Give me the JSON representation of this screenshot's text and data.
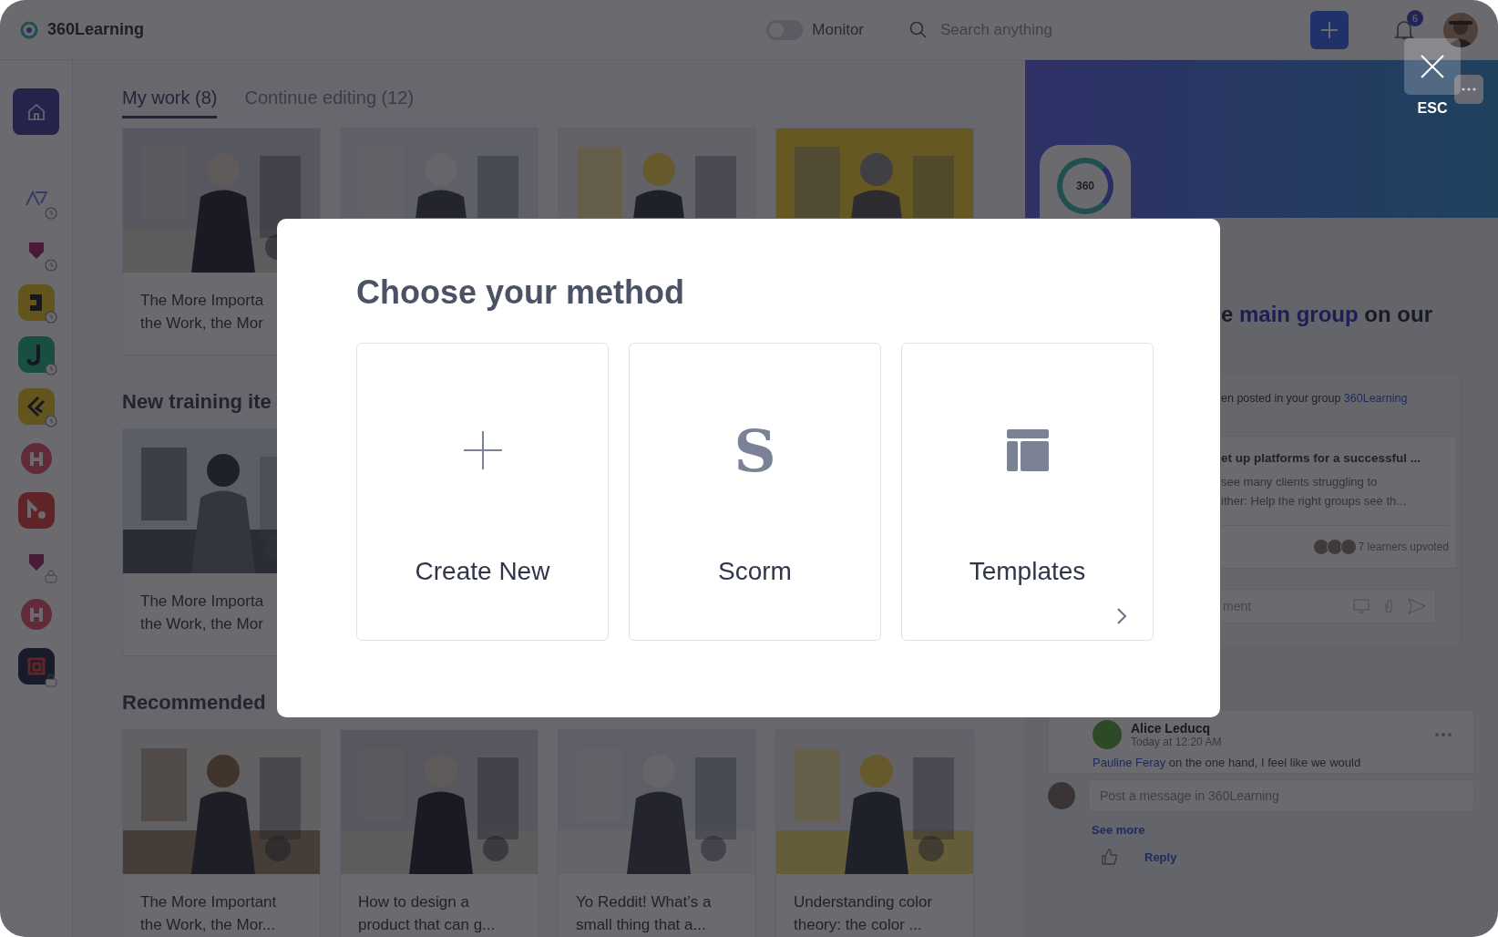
{
  "topbar": {
    "brand": "360Learning",
    "monitor": {
      "label": "Monitor",
      "on": false
    },
    "search": {
      "placeholder": "Search anything"
    },
    "notifications": "6"
  },
  "close": {
    "label": "ESC"
  },
  "sidebar": {
    "home": {
      "selected": true
    },
    "apps": [
      {
        "kind": "mark",
        "pending": true,
        "locked": false
      },
      {
        "kind": "shield",
        "pending": true,
        "locked": false
      },
      {
        "kind": "bracket",
        "pending": true,
        "locked": false
      },
      {
        "kind": "leaf",
        "pending": true,
        "locked": false
      },
      {
        "kind": "arrows",
        "pending": true,
        "locked": false
      },
      {
        "kind": "circle",
        "pending": false,
        "locked": false
      },
      {
        "kind": "dot",
        "pending": false,
        "locked": false
      },
      {
        "kind": "shield",
        "pending": false,
        "locked": true
      },
      {
        "kind": "circle",
        "pending": false,
        "locked": false
      },
      {
        "kind": "frame",
        "pending": false,
        "locked": true
      }
    ]
  },
  "tabs": [
    {
      "label": "My work (8)",
      "selected": true
    },
    {
      "label": "Continue editing (12)",
      "selected": false
    }
  ],
  "sections": [
    {
      "cards": [
        {
          "kind": "picture",
          "title": "The More Importa\nthe Work, the Mor"
        },
        {
          "kind": "picture"
        },
        {
          "kind": "picture"
        },
        {
          "kind": "picture"
        }
      ]
    },
    {
      "heading": "New training ite",
      "cards": [
        {
          "kind": "picture",
          "title": "The More Importa\nthe Work, the Mor"
        }
      ]
    },
    {
      "heading": "Recommended",
      "cards": [
        {
          "kind": "picture",
          "title": "The More Important\nthe Work, the Mor..."
        },
        {
          "kind": "picture",
          "title": "How to design a\nproduct that can g..."
        },
        {
          "kind": "picture",
          "title": "Yo Reddit! What’s a\nsmall thing that a..."
        },
        {
          "kind": "picture",
          "title": "Understanding color\ntheory: the color ..."
        }
      ]
    }
  ],
  "panel": {
    "logo": "360",
    "headline": {
      "before": "e ",
      "link": "main group",
      "after": " on our"
    },
    "notice": {
      "text": "en posted in your group ",
      "link": "360Learning"
    },
    "post": {
      "title": "et up platforms for a successful ...",
      "excerpt": "see many clients struggling to\nither: Help the right groups see th...",
      "upvotes": "7 learners upvoted"
    },
    "comment": {
      "placeholder": "ment"
    },
    "reply": {
      "author": "Alice Leducq",
      "time": "Today at 12:20 AM",
      "mention": "Pauline Feray",
      "text": " on the one hand, I feel like we would"
    },
    "message": {
      "placeholder": "Post a message in 360Learning"
    },
    "see_more": "See more",
    "reply_label": "Reply"
  },
  "modal": {
    "title": "Choose your method",
    "options": [
      {
        "kind": "plus",
        "label": "Create New",
        "chevron": false
      },
      {
        "kind": "glyph",
        "glyph": "S",
        "label": "Scorm",
        "chevron": false
      },
      {
        "kind": "template",
        "label": "Templates",
        "chevron": true
      }
    ]
  }
}
